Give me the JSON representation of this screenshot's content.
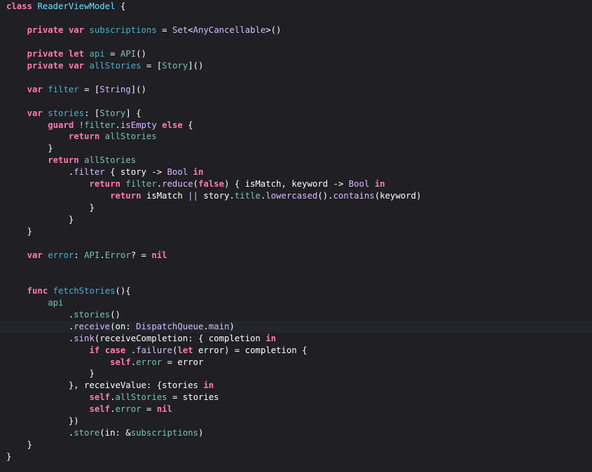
{
  "editor": {
    "language": "swift",
    "current_line_index": 27,
    "colors": {
      "background": "#1f1f24",
      "current_line": "#23252b",
      "keyword": "#ff7ab2",
      "type": "#dabaff",
      "declaration": "#6bdfff",
      "member": "#78c2b3",
      "plain": "#ffffff"
    },
    "lines": [
      [
        {
          "c": "kw",
          "t": "class"
        },
        {
          "c": "plain",
          "t": " "
        },
        {
          "c": "decl",
          "t": "ReaderViewModel"
        },
        {
          "c": "plain",
          "t": " {"
        }
      ],
      [],
      [
        {
          "c": "plain",
          "t": "    "
        },
        {
          "c": "kw",
          "t": "private"
        },
        {
          "c": "plain",
          "t": " "
        },
        {
          "c": "kw",
          "t": "var"
        },
        {
          "c": "plain",
          "t": " "
        },
        {
          "c": "dec2",
          "t": "subscriptions"
        },
        {
          "c": "plain",
          "t": " = "
        },
        {
          "c": "typ",
          "t": "Set"
        },
        {
          "c": "plain",
          "t": "<"
        },
        {
          "c": "typ",
          "t": "AnyCancellable"
        },
        {
          "c": "plain",
          "t": ">()"
        }
      ],
      [],
      [
        {
          "c": "plain",
          "t": "    "
        },
        {
          "c": "kw",
          "t": "private"
        },
        {
          "c": "plain",
          "t": " "
        },
        {
          "c": "kw",
          "t": "let"
        },
        {
          "c": "plain",
          "t": " "
        },
        {
          "c": "dec2",
          "t": "api"
        },
        {
          "c": "plain",
          "t": " = "
        },
        {
          "c": "mem",
          "t": "API"
        },
        {
          "c": "plain",
          "t": "()"
        }
      ],
      [
        {
          "c": "plain",
          "t": "    "
        },
        {
          "c": "kw",
          "t": "private"
        },
        {
          "c": "plain",
          "t": " "
        },
        {
          "c": "kw",
          "t": "var"
        },
        {
          "c": "plain",
          "t": " "
        },
        {
          "c": "dec2",
          "t": "allStories"
        },
        {
          "c": "plain",
          "t": " = ["
        },
        {
          "c": "mem",
          "t": "Story"
        },
        {
          "c": "plain",
          "t": "]()"
        }
      ],
      [],
      [
        {
          "c": "plain",
          "t": "    "
        },
        {
          "c": "kw",
          "t": "var"
        },
        {
          "c": "plain",
          "t": " "
        },
        {
          "c": "dec2",
          "t": "filter"
        },
        {
          "c": "plain",
          "t": " = ["
        },
        {
          "c": "typ",
          "t": "String"
        },
        {
          "c": "plain",
          "t": "]()"
        }
      ],
      [],
      [
        {
          "c": "plain",
          "t": "    "
        },
        {
          "c": "kw",
          "t": "var"
        },
        {
          "c": "plain",
          "t": " "
        },
        {
          "c": "dec2",
          "t": "stories"
        },
        {
          "c": "plain",
          "t": ": ["
        },
        {
          "c": "mem",
          "t": "Story"
        },
        {
          "c": "plain",
          "t": "] {"
        }
      ],
      [
        {
          "c": "plain",
          "t": "        "
        },
        {
          "c": "kw",
          "t": "guard"
        },
        {
          "c": "plain",
          "t": " "
        },
        {
          "c": "typ",
          "t": "!"
        },
        {
          "c": "mem",
          "t": "filter"
        },
        {
          "c": "plain",
          "t": "."
        },
        {
          "c": "typ",
          "t": "isEmpty"
        },
        {
          "c": "plain",
          "t": " "
        },
        {
          "c": "kw",
          "t": "else"
        },
        {
          "c": "plain",
          "t": " {"
        }
      ],
      [
        {
          "c": "plain",
          "t": "            "
        },
        {
          "c": "kw",
          "t": "return"
        },
        {
          "c": "plain",
          "t": " "
        },
        {
          "c": "mem",
          "t": "allStories"
        }
      ],
      [
        {
          "c": "plain",
          "t": "        }"
        }
      ],
      [
        {
          "c": "plain",
          "t": "        "
        },
        {
          "c": "kw",
          "t": "return"
        },
        {
          "c": "plain",
          "t": " "
        },
        {
          "c": "mem",
          "t": "allStories"
        }
      ],
      [
        {
          "c": "plain",
          "t": "            ."
        },
        {
          "c": "typ",
          "t": "filter"
        },
        {
          "c": "plain",
          "t": " { story -> "
        },
        {
          "c": "typ",
          "t": "Bool"
        },
        {
          "c": "plain",
          "t": " "
        },
        {
          "c": "kw",
          "t": "in"
        }
      ],
      [
        {
          "c": "plain",
          "t": "                "
        },
        {
          "c": "kw",
          "t": "return"
        },
        {
          "c": "plain",
          "t": " "
        },
        {
          "c": "mem",
          "t": "filter"
        },
        {
          "c": "plain",
          "t": "."
        },
        {
          "c": "typ",
          "t": "reduce"
        },
        {
          "c": "plain",
          "t": "("
        },
        {
          "c": "kw",
          "t": "false"
        },
        {
          "c": "plain",
          "t": ") { isMatch, keyword -> "
        },
        {
          "c": "typ",
          "t": "Bool"
        },
        {
          "c": "plain",
          "t": " "
        },
        {
          "c": "kw",
          "t": "in"
        }
      ],
      [
        {
          "c": "plain",
          "t": "                    "
        },
        {
          "c": "kw",
          "t": "return"
        },
        {
          "c": "plain",
          "t": " isMatch "
        },
        {
          "c": "typ",
          "t": "||"
        },
        {
          "c": "plain",
          "t": " story."
        },
        {
          "c": "mem",
          "t": "title"
        },
        {
          "c": "plain",
          "t": "."
        },
        {
          "c": "typ",
          "t": "lowercased"
        },
        {
          "c": "plain",
          "t": "()."
        },
        {
          "c": "typ",
          "t": "contains"
        },
        {
          "c": "plain",
          "t": "(keyword)"
        }
      ],
      [
        {
          "c": "plain",
          "t": "                }"
        }
      ],
      [
        {
          "c": "plain",
          "t": "            }"
        }
      ],
      [
        {
          "c": "plain",
          "t": "    }"
        }
      ],
      [],
      [
        {
          "c": "plain",
          "t": "    "
        },
        {
          "c": "kw",
          "t": "var"
        },
        {
          "c": "plain",
          "t": " "
        },
        {
          "c": "dec2",
          "t": "error"
        },
        {
          "c": "plain",
          "t": ": "
        },
        {
          "c": "mem",
          "t": "API"
        },
        {
          "c": "plain",
          "t": "."
        },
        {
          "c": "mem",
          "t": "Error"
        },
        {
          "c": "plain",
          "t": "? = "
        },
        {
          "c": "kw",
          "t": "nil"
        }
      ],
      [],
      [],
      [
        {
          "c": "plain",
          "t": "    "
        },
        {
          "c": "kw",
          "t": "func"
        },
        {
          "c": "plain",
          "t": " "
        },
        {
          "c": "dec2",
          "t": "fetchStories"
        },
        {
          "c": "plain",
          "t": "(){"
        }
      ],
      [
        {
          "c": "plain",
          "t": "        "
        },
        {
          "c": "mem",
          "t": "api"
        }
      ],
      [
        {
          "c": "plain",
          "t": "            ."
        },
        {
          "c": "mem",
          "t": "stories"
        },
        {
          "c": "plain",
          "t": "()"
        }
      ],
      [
        {
          "c": "plain",
          "t": "            ."
        },
        {
          "c": "typ",
          "t": "receive"
        },
        {
          "c": "plain",
          "t": "(on: "
        },
        {
          "c": "typ",
          "t": "DispatchQueue"
        },
        {
          "c": "plain",
          "t": "."
        },
        {
          "c": "typ",
          "t": "main"
        },
        {
          "c": "plain",
          "t": ")"
        }
      ],
      [
        {
          "c": "plain",
          "t": "            ."
        },
        {
          "c": "typ",
          "t": "sink"
        },
        {
          "c": "plain",
          "t": "(receiveCompletion: { completion "
        },
        {
          "c": "kw",
          "t": "in"
        }
      ],
      [
        {
          "c": "plain",
          "t": "                "
        },
        {
          "c": "kw",
          "t": "if"
        },
        {
          "c": "plain",
          "t": " "
        },
        {
          "c": "kw",
          "t": "case"
        },
        {
          "c": "plain",
          "t": " ."
        },
        {
          "c": "typ",
          "t": "failure"
        },
        {
          "c": "plain",
          "t": "("
        },
        {
          "c": "kw",
          "t": "let"
        },
        {
          "c": "plain",
          "t": " error) = completion {"
        }
      ],
      [
        {
          "c": "plain",
          "t": "                    "
        },
        {
          "c": "kw",
          "t": "self"
        },
        {
          "c": "plain",
          "t": "."
        },
        {
          "c": "mem",
          "t": "error"
        },
        {
          "c": "plain",
          "t": " = error"
        }
      ],
      [
        {
          "c": "plain",
          "t": "                }"
        }
      ],
      [
        {
          "c": "plain",
          "t": "            }, receiveValue: {stories "
        },
        {
          "c": "kw",
          "t": "in"
        }
      ],
      [
        {
          "c": "plain",
          "t": "                "
        },
        {
          "c": "kw",
          "t": "self"
        },
        {
          "c": "plain",
          "t": "."
        },
        {
          "c": "mem",
          "t": "allStories"
        },
        {
          "c": "plain",
          "t": " = stories"
        }
      ],
      [
        {
          "c": "plain",
          "t": "                "
        },
        {
          "c": "kw",
          "t": "self"
        },
        {
          "c": "plain",
          "t": "."
        },
        {
          "c": "mem",
          "t": "error"
        },
        {
          "c": "plain",
          "t": " = "
        },
        {
          "c": "kw",
          "t": "nil"
        }
      ],
      [
        {
          "c": "plain",
          "t": "            })"
        }
      ],
      [
        {
          "c": "plain",
          "t": "            ."
        },
        {
          "c": "mem",
          "t": "store"
        },
        {
          "c": "plain",
          "t": "(in: &"
        },
        {
          "c": "mem",
          "t": "subscriptions"
        },
        {
          "c": "plain",
          "t": ")"
        }
      ],
      [
        {
          "c": "plain",
          "t": "    }"
        }
      ],
      [
        {
          "c": "plain",
          "t": "}"
        }
      ]
    ]
  }
}
